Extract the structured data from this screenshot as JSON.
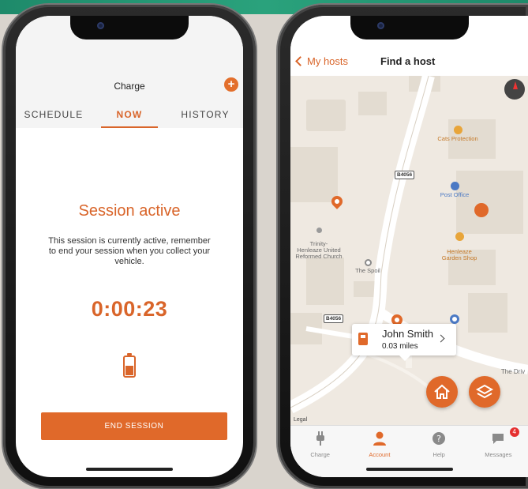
{
  "charge_screen": {
    "title": "Charge",
    "add_symbol": "+",
    "tabs": [
      {
        "label": "SCHEDULE",
        "active": false
      },
      {
        "label": "NOW",
        "active": true
      },
      {
        "label": "HISTORY",
        "active": false
      }
    ],
    "session_title": "Session active",
    "session_message": "This session is currently active, remember to end your session when you collect your vehicle.",
    "timer": "0:00:23",
    "battery_icon": "battery-charging-icon",
    "end_button_label": "END SESSION"
  },
  "map_screen": {
    "back_label": "My hosts",
    "title": "Find a host",
    "compass_icon": "compass-icon",
    "pois": {
      "cats_protection": "Cats Protection",
      "post_office": "Post Office",
      "trinity": "Trinity-\nHenleaze United\nReformed Church",
      "henleaze": "Henleaze\nGarden Shop",
      "the_spoil": "The Spoil",
      "the_drive": "The Driv"
    },
    "road_labels": [
      "B4056",
      "B4056"
    ],
    "callout": {
      "name": "John Smith",
      "distance": "0.03 miles"
    },
    "legal": "Legal",
    "tabbar": [
      {
        "label": "Charge",
        "icon": "plug-icon",
        "active": false
      },
      {
        "label": "Account",
        "icon": "person-icon",
        "active": true
      },
      {
        "label": "Help",
        "icon": "help-icon",
        "active": false
      },
      {
        "label": "Messages",
        "icon": "chat-icon",
        "active": false,
        "badge": "4"
      }
    ]
  },
  "colors": {
    "accent": "#e0692a",
    "map_bg": "#efe9e1",
    "badge": "#e53030",
    "band": "#2aa27c"
  }
}
